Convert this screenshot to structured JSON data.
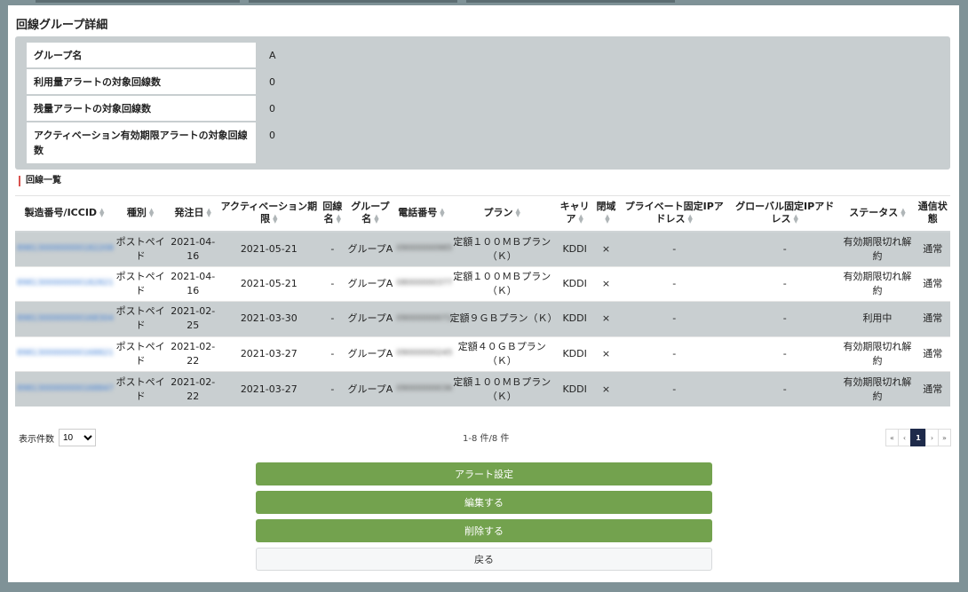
{
  "title": "回線グループ詳細",
  "info": [
    {
      "label": "グループ名",
      "value": "A"
    },
    {
      "label": "利用量アラートの対象回線数",
      "value": "0"
    },
    {
      "label": "残量アラートの対象回線数",
      "value": "0"
    },
    {
      "label": "アクティベーション有効期限アラートの対象回線数",
      "value": "0"
    }
  ],
  "section_title": "回線一覧",
  "columns": [
    "製造番号/ICCID",
    "種別",
    "発注日",
    "アクティベーション期限",
    "回線名",
    "グループ名",
    "電話番号",
    "プラン",
    "キャリア",
    "閉域",
    "プライベート固定IPアドレス",
    "グローバル固定IPアドレス",
    "ステータス",
    "通信状態"
  ],
  "rows": [
    {
      "iccid": "8981300000000182208",
      "type": "ポストペイド",
      "order_date": "2021-04-16",
      "activation": "2021-05-21",
      "line_name": "-",
      "group": "グループA",
      "phone": "09000000985",
      "plan": "定額１００ＭＢプラン（Ｋ）",
      "carrier": "KDDI",
      "closed": "×",
      "private_ip": "-",
      "global_ip": "-",
      "status": "有効期限切れ解約",
      "comm": "通常"
    },
    {
      "iccid": "8981300000000182821",
      "type": "ポストペイド",
      "order_date": "2021-04-16",
      "activation": "2021-05-21",
      "line_name": "-",
      "group": "グループA",
      "phone": "08000000377",
      "plan": "定額１００ＭＢプラン（Ｋ）",
      "carrier": "KDDI",
      "closed": "×",
      "private_ip": "-",
      "global_ip": "-",
      "status": "有効期限切れ解約",
      "comm": "通常"
    },
    {
      "iccid": "8981300000000168304",
      "type": "ポストペイド",
      "order_date": "2021-02-25",
      "activation": "2021-03-30",
      "line_name": "-",
      "group": "グループA",
      "phone": "09000000072",
      "plan": "定額９ＧＢプラン（Ｋ）",
      "carrier": "KDDI",
      "closed": "×",
      "private_ip": "-",
      "global_ip": "-",
      "status": "利用中",
      "comm": "通常"
    },
    {
      "iccid": "8981300000000168821",
      "type": "ポストペイド",
      "order_date": "2021-02-22",
      "activation": "2021-03-27",
      "line_name": "-",
      "group": "グループA",
      "phone": "09000000245",
      "plan": "定額４０ＧＢプラン（Ｋ）",
      "carrier": "KDDI",
      "closed": "×",
      "private_ip": "-",
      "global_ip": "-",
      "status": "有効期限切れ解約",
      "comm": "通常"
    },
    {
      "iccid": "8981300000000168847",
      "type": "ポストペイド",
      "order_date": "2021-02-22",
      "activation": "2021-03-27",
      "line_name": "-",
      "group": "グループA",
      "phone": "09000000036",
      "plan": "定額１００ＭＢプラン（Ｋ）",
      "carrier": "KDDI",
      "closed": "×",
      "private_ip": "-",
      "global_ip": "-",
      "status": "有効期限切れ解約",
      "comm": "通常"
    }
  ],
  "per_page_label": "表示件数",
  "per_page_value": "10",
  "count_text": "1-8 件/8 件",
  "pager": [
    "«",
    "‹",
    "1",
    "›",
    "»"
  ],
  "buttons": {
    "alert": "アラート設定",
    "edit": "編集する",
    "delete": "削除する",
    "back": "戻る"
  }
}
